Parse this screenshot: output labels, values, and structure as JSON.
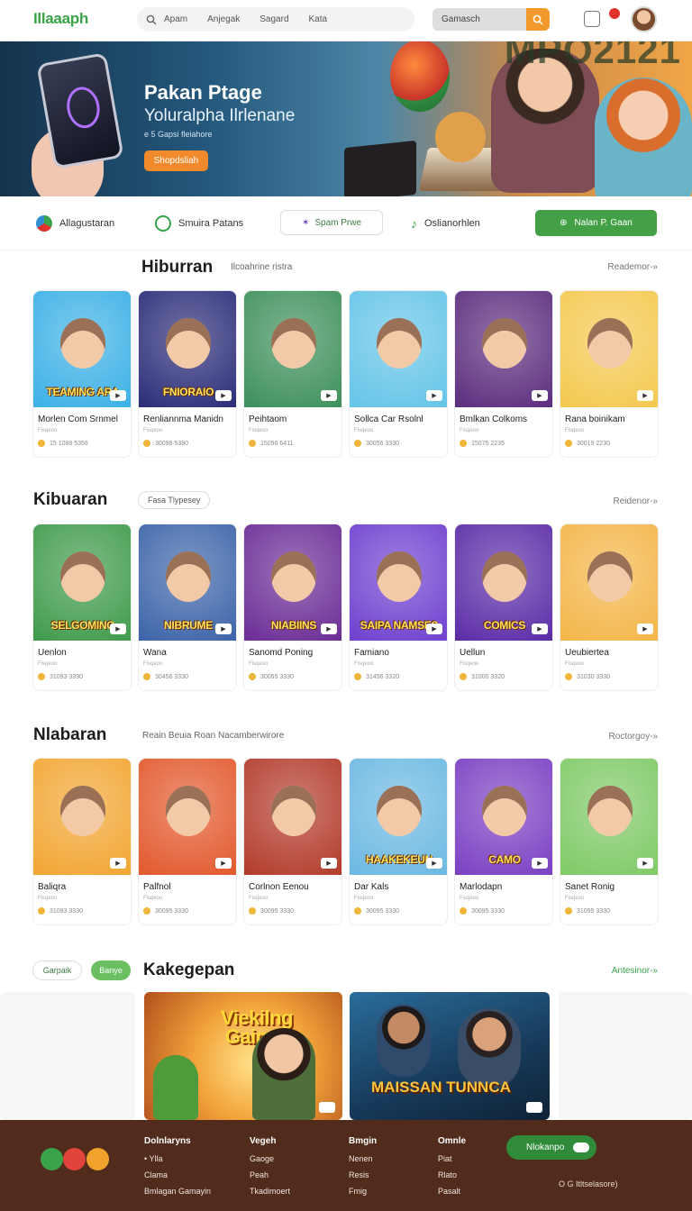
{
  "header": {
    "logo": "Illaaaph",
    "nav": [
      "Apam",
      "Anjegak",
      "Sagard",
      "Kata"
    ],
    "search_placeholder": "Gamasch"
  },
  "hero": {
    "title": "Pakan Ptage",
    "subtitle": "Yoluralpha Ilrlenane",
    "tagline": "e 5 Gapsi fleiahore",
    "button": "Shopdsliah",
    "watermark": "MPO2121"
  },
  "categories": {
    "items": [
      "Allagustaran",
      "Smuira Patans",
      "Spam Prwe",
      "Oslianorhlen"
    ],
    "cta": "Nalan P. Gaan"
  },
  "sections": [
    {
      "title": "Hiburran",
      "subtitle": "Ilcoahrine ristra",
      "link": "Reademor-»",
      "cards": [
        {
          "title": "Morlen Com Srnmel",
          "sub": "Fisqeoo",
          "meta": "15 1088 5355",
          "banner": "TEAMING ARA",
          "color": "#3bb0e6"
        },
        {
          "title": "Renliannma Manidn",
          "sub": "Fisqeoo",
          "meta": "30098 5380",
          "banner": "FNIORAIO",
          "color": "#2a2c78"
        },
        {
          "title": "Peihtaom",
          "sub": "Fisqeoo",
          "meta": "15090 6411",
          "banner": "",
          "color": "#3d8f5a"
        },
        {
          "title": "Sollca Car Rsolnl",
          "sub": "Fisqeoo",
          "meta": "30056 3330",
          "banner": "",
          "color": "#64c4e8"
        },
        {
          "title": "Bmlkan Colkoms",
          "sub": "Fisqeoo",
          "meta": "15075 2235",
          "banner": "",
          "color": "#5b2c7d"
        },
        {
          "title": "Rana boinikam",
          "sub": "Fisqeoo",
          "meta": "30019 2230",
          "banner": "",
          "color": "#f4c84e"
        }
      ]
    },
    {
      "title": "Kibuaran",
      "chip": "Fasa Tlypesey",
      "link": "Reidenor-»",
      "cards": [
        {
          "title": "Uenlon",
          "sub": "Fisqeoo",
          "meta": "31093 3390",
          "banner": "SELGOMING",
          "color": "#3f9a4a"
        },
        {
          "title": "Wana",
          "sub": "Fisqeoo",
          "meta": "30456 3330",
          "banner": "NIBRUME",
          "color": "#3b63a8"
        },
        {
          "title": "Sanomd Poning",
          "sub": "Fisqeoo",
          "meta": "30055 3330",
          "banner": "NIABIINS",
          "color": "#6a2b95"
        },
        {
          "title": "Famiano",
          "sub": "Fisqeoo",
          "meta": "31456 3320",
          "banner": "SAIPA NAMSES",
          "color": "#6e3fcf"
        },
        {
          "title": "Uellun",
          "sub": "Fisqeoo",
          "meta": "31000 3320",
          "banner": "COMICS",
          "color": "#5a2aa6"
        },
        {
          "title": "Ueubiertea",
          "sub": "Fisqeoo",
          "meta": "31030 3330",
          "banner": "",
          "color": "#f3b547"
        }
      ]
    },
    {
      "title": "Nlabaran",
      "subtitle": "Reain Beuia Roan   Nacamberwirore",
      "link": "Roctorgoy-»",
      "cards": [
        {
          "title": "Baliqra",
          "sub": "Fisqeoo",
          "meta": "31093 3330",
          "banner": "",
          "color": "#f2a531"
        },
        {
          "title": "Palfnol",
          "sub": "Fisqeoo",
          "meta": "30095 3330",
          "banner": "",
          "color": "#e2582c"
        },
        {
          "title": "Corlnon Eenou",
          "sub": "Fisqeoo",
          "meta": "30095 3330",
          "banner": "",
          "color": "#b23a2a"
        },
        {
          "title": "Dar Kals",
          "sub": "Fisqeoo",
          "meta": "30095 3330",
          "banner": "HAAKEKEUN",
          "color": "#6bb8e2"
        },
        {
          "title": "Marlodapn",
          "sub": "Fisqeoo",
          "meta": "30095 3330",
          "banner": "CAMO",
          "color": "#7a3fc2"
        },
        {
          "title": "Sanet Ronig",
          "sub": "Fisqeoo",
          "meta": "31095 3330",
          "banner": "",
          "color": "#7ec965"
        }
      ]
    }
  ],
  "featured": {
    "title": "Kakegepan",
    "tabs": [
      "Garpaik",
      "Banye"
    ],
    "link": "Antesinor-»",
    "banners": [
      "Viekilng Gaines",
      "MAISSAN TUNNCA"
    ]
  },
  "footer": {
    "columns": [
      {
        "heading": "Dolnlaryns",
        "items": [
          "• Ylla",
          "Clama",
          "Bmlagan Gamayin"
        ]
      },
      {
        "heading": "Vegeh",
        "items": [
          "Gaoge",
          "Peah",
          "Tkadimoert"
        ]
      },
      {
        "heading": "Bmgin",
        "items": [
          "Nenen",
          "Resis",
          "Fmig"
        ]
      },
      {
        "heading": "Omnle",
        "items": [
          "Piat",
          "Rlato",
          "Pasalt"
        ]
      }
    ],
    "toggle": "Nlokanpo",
    "small": "O  G  Itltselasore)"
  }
}
